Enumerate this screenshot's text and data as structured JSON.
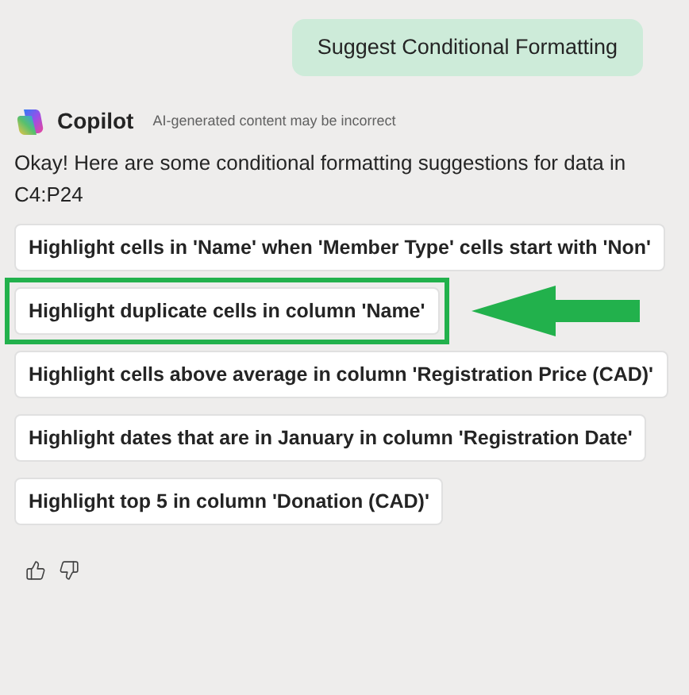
{
  "user_message": "Suggest Conditional Formatting",
  "assistant": {
    "name": "Copilot",
    "disclaimer": "AI-generated content may be incorrect",
    "intro": "Okay! Here are some conditional formatting suggestions for data in C4:P24"
  },
  "suggestions": [
    {
      "label": "Highlight cells in 'Name' when 'Member Type' cells start with 'Non'",
      "highlighted": false
    },
    {
      "label": "Highlight duplicate cells in column 'Name'",
      "highlighted": true
    },
    {
      "label": "Highlight cells above average in column 'Registration Price (CAD)'",
      "highlighted": false
    },
    {
      "label": "Highlight dates that are in January in column 'Registration Date'",
      "highlighted": false
    },
    {
      "label": "Highlight top 5 in column 'Donation (CAD)'",
      "highlighted": false
    }
  ]
}
